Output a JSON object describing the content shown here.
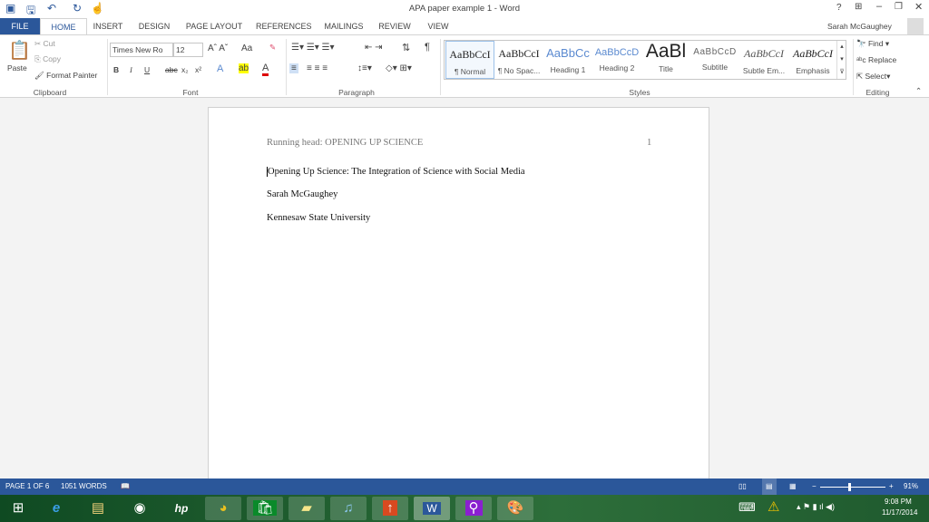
{
  "window": {
    "title": "APA paper example 1 - Word",
    "user": "Sarah McGaughey",
    "help": "?",
    "controls": [
      "ribbon-display",
      "minimize",
      "restore",
      "close"
    ]
  },
  "tabs": [
    "FILE",
    "HOME",
    "INSERT",
    "DESIGN",
    "PAGE LAYOUT",
    "REFERENCES",
    "MAILINGS",
    "REVIEW",
    "VIEW"
  ],
  "clipboard": {
    "paste": "Paste",
    "cut": "Cut",
    "copy": "Copy",
    "format_painter": "Format Painter",
    "group": "Clipboard"
  },
  "font": {
    "name": "Times New Ro",
    "size": "12",
    "case": "Aa",
    "bold": "B",
    "italic": "I",
    "underline": "U",
    "strike": "abc",
    "sub": "x₂",
    "sup": "x²",
    "group": "Font"
  },
  "paragraph": {
    "group": "Paragraph",
    "pilcrow": "¶"
  },
  "styles": {
    "group": "Styles",
    "items": [
      {
        "sample": "AaBbCcI",
        "label": "¶ Normal"
      },
      {
        "sample": "AaBbCcI",
        "label": "¶ No Spac..."
      },
      {
        "sample": "AaBbCc",
        "label": "Heading 1"
      },
      {
        "sample": "AaBbCcD",
        "label": "Heading 2"
      },
      {
        "sample": "AaBl",
        "label": "Title"
      },
      {
        "sample": "AaBbCcD",
        "label": "Subtitle"
      },
      {
        "sample": "AaBbCcI",
        "label": "Subtle Em..."
      },
      {
        "sample": "AaBbCcI",
        "label": "Emphasis"
      }
    ]
  },
  "editing": {
    "find": "Find",
    "replace": "Replace",
    "select": "Select",
    "group": "Editing"
  },
  "document": {
    "running_head": "Running head: OPENING UP SCIENCE",
    "page_number": "1",
    "title": "Opening Up Science: The Integration of Science with Social Media",
    "author": "Sarah McGaughey",
    "institution": "Kennesaw State University"
  },
  "status": {
    "page": "PAGE 1 OF 6",
    "words": "1051 WORDS",
    "zoom": "91%",
    "zoom_level": 91
  },
  "taskbar": {
    "time": "9:08 PM",
    "date": "11/17/2014",
    "apps": [
      "start",
      "internet-explorer",
      "file-explorer",
      "webcam",
      "hp",
      "chrome",
      "store",
      "sticky-notes",
      "itunes",
      "office-upload",
      "word",
      "magnifier",
      "paint"
    ]
  },
  "colors": {
    "accent": "#2b579a",
    "taskbar": "#1e5a2e"
  }
}
